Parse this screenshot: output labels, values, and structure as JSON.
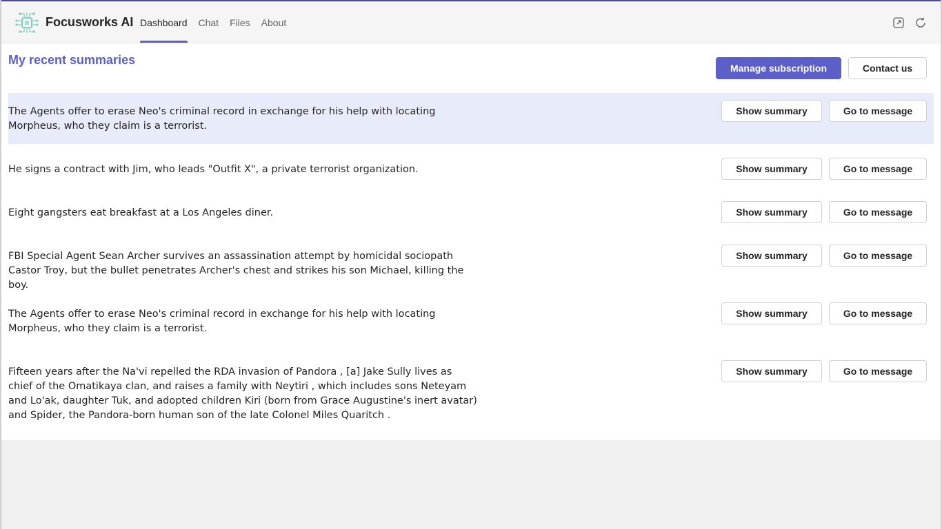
{
  "app": {
    "name": "Focusworks AI"
  },
  "tabs": [
    {
      "label": "Dashboard",
      "active": true
    },
    {
      "label": "Chat",
      "active": false
    },
    {
      "label": "Files",
      "active": false
    },
    {
      "label": "About",
      "active": false
    }
  ],
  "header_icons": [
    "open-in-new-window-icon",
    "refresh-icon"
  ],
  "page": {
    "title": "My recent summaries",
    "manage_label": "Manage subscription",
    "contact_label": "Contact us"
  },
  "row_buttons": {
    "show": "Show summary",
    "goto": "Go to message"
  },
  "summaries": [
    {
      "text": "The Agents offer to erase Neo's criminal record in exchange for his help with locating Morpheus, who they claim is a terrorist.",
      "highlighted": true
    },
    {
      "text": "He signs a contract with Jim, who leads \"Outfit X\", a private terrorist organization.",
      "highlighted": false
    },
    {
      "text": "Eight gangsters eat breakfast at a Los Angeles diner.",
      "highlighted": false
    },
    {
      "text": "FBI Special Agent Sean Archer survives an assassination attempt by homicidal sociopath Castor Troy, but the bullet penetrates Archer's chest and strikes his son Michael, killing the boy.",
      "highlighted": false
    },
    {
      "text": "The Agents offer to erase Neo's criminal record in exchange for his help with locating Morpheus, who they claim is a terrorist.",
      "highlighted": false
    },
    {
      "text": "Fifteen years after the Na'vi repelled the RDA invasion of Pandora , [a] Jake Sully lives as chief of the Omatikaya clan, and raises a family with Neytiri , which includes sons Neteyam and Lo'ak, daughter Tuk, and adopted children Kiri (born from Grace Augustine's inert avatar) and Spider, the Pandora-born human son of the late Colonel Miles Quaritch .",
      "highlighted": false
    }
  ],
  "colors": {
    "accent": "#5b5fc7",
    "highlight_row": "#e8ebfa"
  }
}
